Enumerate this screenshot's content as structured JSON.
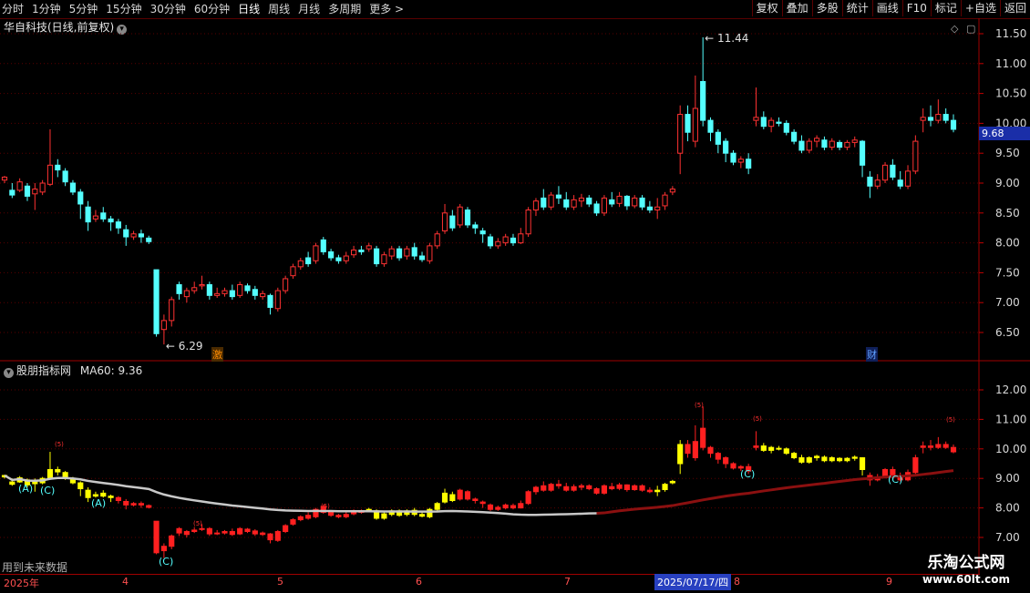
{
  "toolbar": {
    "periods": [
      "分时",
      "1分钟",
      "5分钟",
      "15分钟",
      "30分钟",
      "60分钟",
      "日线",
      "周线",
      "月线",
      "多周期",
      "更多 >"
    ],
    "active_period": "日线",
    "actions": [
      "复权",
      "叠加",
      "多股",
      "统计",
      "画线",
      "F10",
      "标记",
      "+自选",
      "返回"
    ]
  },
  "main_panel": {
    "title": "华自科技(日线,前复权)",
    "high_label": "11.44",
    "low_label": "6.29",
    "current_price": "9.68",
    "marker_ji": "激",
    "marker_cai": "财",
    "y_ticks": [
      "11.50",
      "11.00",
      "10.50",
      "10.00",
      "9.50",
      "9.00",
      "8.50",
      "8.00",
      "7.50",
      "7.00",
      "6.50"
    ]
  },
  "indicator_panel": {
    "title": "股朋指标网",
    "ma_text": "MA60: 9.36",
    "y_ticks": [
      "12.00",
      "11.00",
      "10.00",
      "9.00",
      "8.00",
      "7.00"
    ],
    "labels": [
      "(A)",
      "(C)",
      "(A)",
      "(C)",
      "(C)",
      "(C)"
    ],
    "note": "用到未来数据"
  },
  "date_axis": {
    "year": "2025年",
    "months": [
      "4",
      "5",
      "6",
      "7",
      "8",
      "9"
    ],
    "selected_date": "2025/07/17/四"
  },
  "watermark": {
    "name": "乐淘公式网",
    "url": "www.60lt.com"
  },
  "colors": {
    "up": "#ff3232",
    "down": "#54ffff",
    "ind_up": "#ff2020",
    "ind_warn": "#ffff00",
    "ma_gray": "#c8c8c8",
    "ma_red": "#8b1010",
    "price_badge": "#1a2ea8"
  }
}
